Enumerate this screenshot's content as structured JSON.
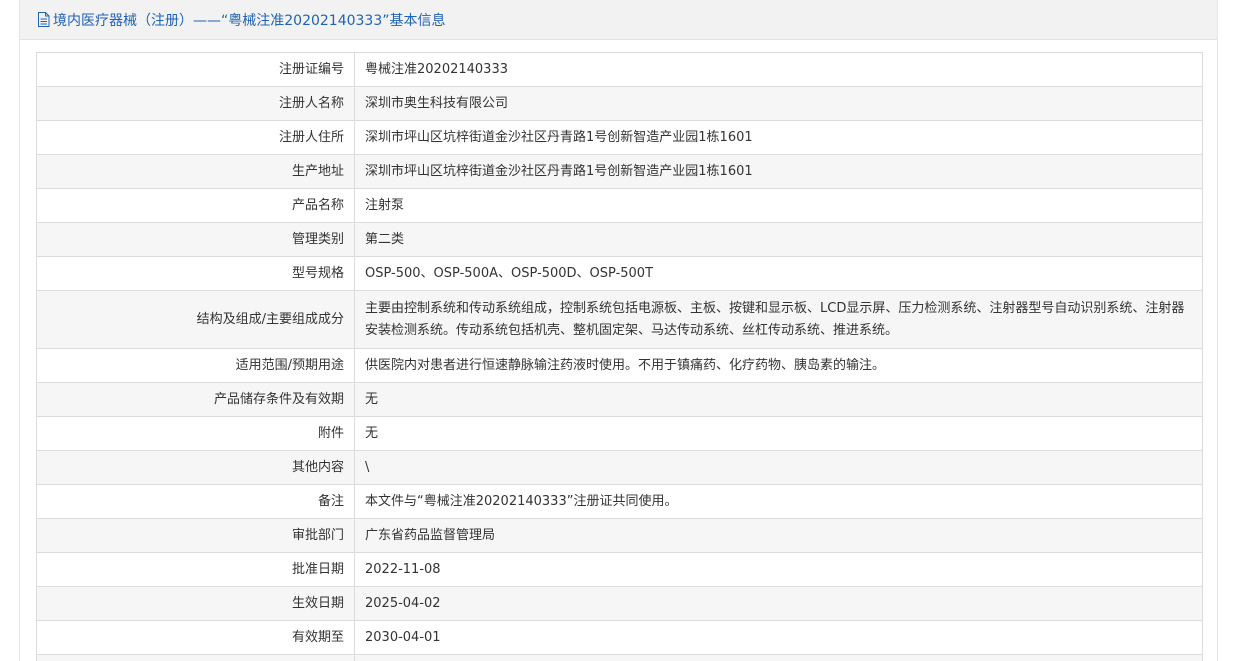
{
  "header": {
    "title": "境内医疗器械（注册）——“粤械注准20202140333”基本信息"
  },
  "rows": [
    {
      "label": "注册证编号",
      "value": "粤械注准20202140333"
    },
    {
      "label": "注册人名称",
      "value": "深圳市奥生科技有限公司"
    },
    {
      "label": "注册人住所",
      "value": "深圳市坪山区坑梓街道金沙社区丹青路1号创新智造产业园1栋1601"
    },
    {
      "label": "生产地址",
      "value": "深圳市坪山区坑梓街道金沙社区丹青路1号创新智造产业园1栋1601"
    },
    {
      "label": "产品名称",
      "value": "注射泵"
    },
    {
      "label": "管理类别",
      "value": "第二类"
    },
    {
      "label": "型号规格",
      "value": "OSP-500、OSP-500A、OSP-500D、OSP-500T"
    },
    {
      "label": "结构及组成/主要组成成分",
      "value": "主要由控制系统和传动系统组成，控制系统包括电源板、主板、按键和显示板、LCD显示屏、压力检测系统、注射器型号自动识别系统、注射器安装检测系统。传动系统包括机壳、整机固定架、马达传动系统、丝杠传动系统、推进系统。"
    },
    {
      "label": "适用范围/预期用途",
      "value": "供医院内对患者进行恒速静脉输注药液时使用。不用于镇痛药、化疗药物、胰岛素的输注。"
    },
    {
      "label": "产品储存条件及有效期",
      "value": "无"
    },
    {
      "label": "附件",
      "value": "无"
    },
    {
      "label": "其他内容",
      "value": "\\"
    },
    {
      "label": "备注",
      "value": "本文件与“粤械注准20202140333”注册证共同使用。"
    },
    {
      "label": "审批部门",
      "value": "广东省药品监督管理局"
    },
    {
      "label": "批准日期",
      "value": "2022-11-08"
    },
    {
      "label": "生效日期",
      "value": "2025-04-02"
    },
    {
      "label": "有效期至",
      "value": "2030-04-01"
    },
    {
      "label": "",
      "value": ""
    }
  ]
}
